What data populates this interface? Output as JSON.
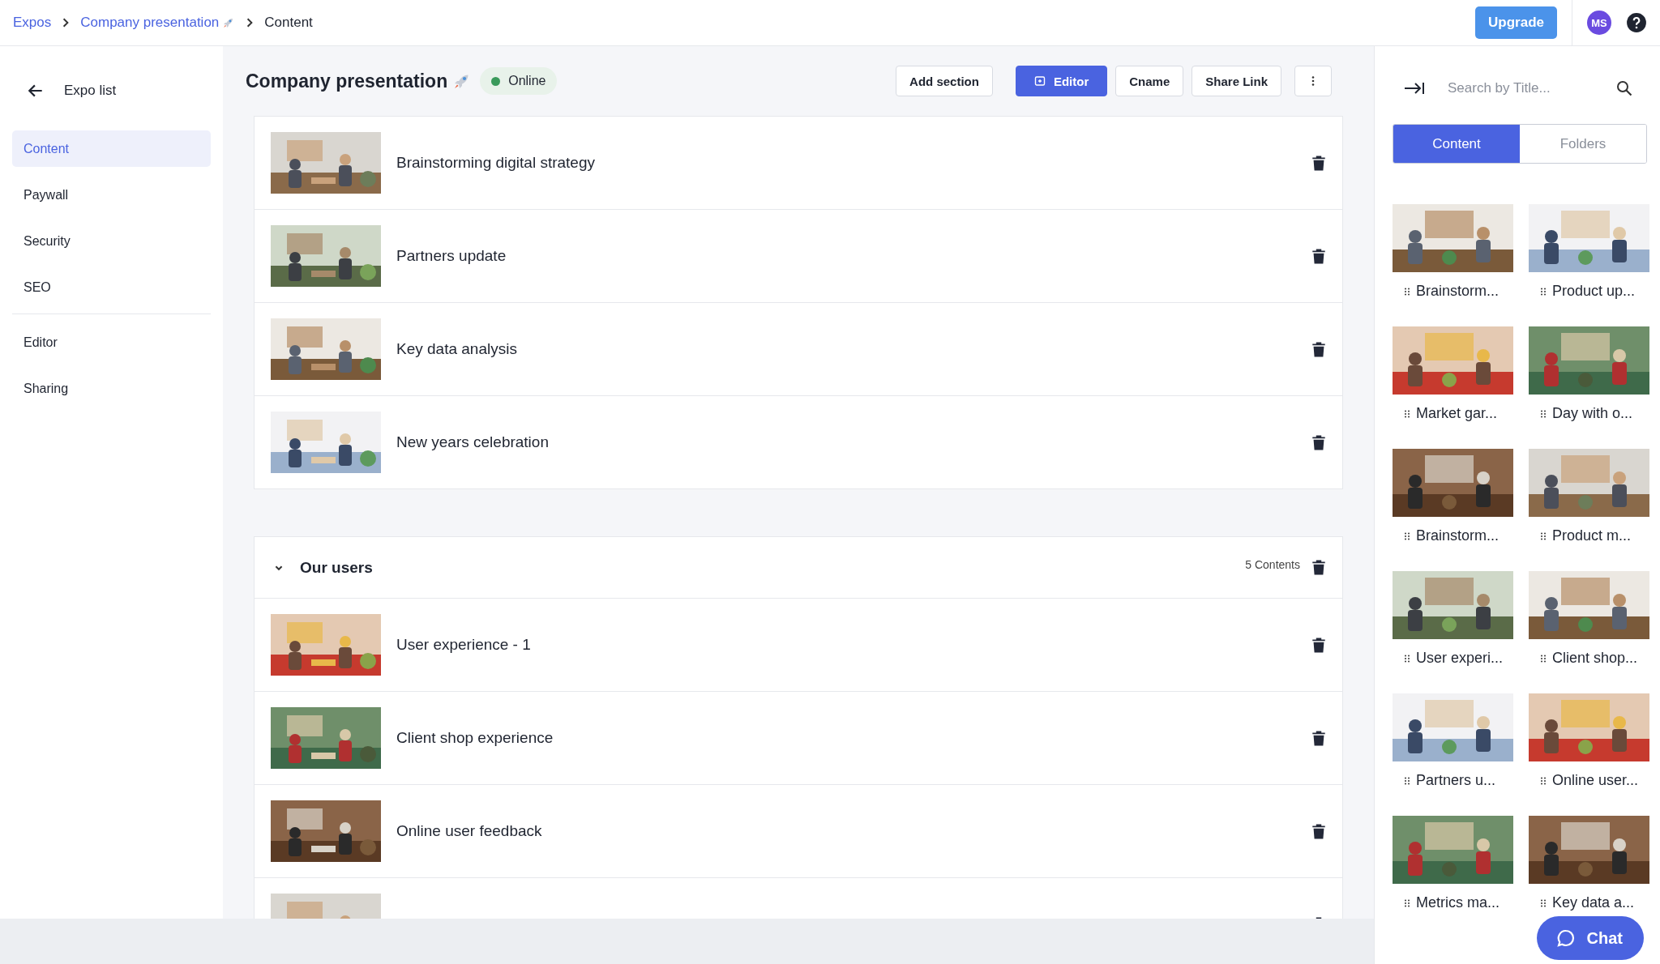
{
  "breadcrumb": [
    {
      "label": "Expos"
    },
    {
      "label": "Company presentation"
    },
    {
      "label": "Content"
    }
  ],
  "topbar": {
    "upgrade": "Upgrade",
    "avatar": "MS"
  },
  "sidebar": {
    "back": "Expo list",
    "groups": [
      [
        {
          "label": "Content",
          "selected": true
        },
        {
          "label": "Paywall",
          "selected": false
        },
        {
          "label": "Security",
          "selected": false
        },
        {
          "label": "SEO",
          "selected": false
        }
      ],
      [
        {
          "label": "Editor",
          "selected": false
        },
        {
          "label": "Sharing",
          "selected": false
        }
      ]
    ]
  },
  "header": {
    "title": "Company presentation",
    "status": "Online",
    "online": true,
    "buttons": [
      {
        "kind": "default",
        "label": "Add section"
      },
      {
        "kind": "primary",
        "label": "Editor"
      },
      {
        "kind": "default",
        "label": "Cname"
      },
      {
        "kind": "default",
        "label": "Share Link"
      },
      {
        "kind": "more"
      }
    ]
  },
  "sections": [
    {
      "items": [
        {
          "kind": "content",
          "title": "Brainstorming digital strategy"
        },
        {
          "kind": "content",
          "title": "Partners update"
        },
        {
          "kind": "content",
          "title": "Key data analysis"
        },
        {
          "kind": "content",
          "title": "New years celebration"
        }
      ]
    },
    {
      "title": "Our users",
      "count": "5 Contents",
      "expanded": true,
      "items": [
        {
          "kind": "content",
          "title": "User experience - 1"
        },
        {
          "kind": "content",
          "title": "Client shop experience"
        },
        {
          "kind": "content",
          "title": "Online user feedback"
        },
        {
          "kind": "picture"
        }
      ]
    }
  ],
  "library": {
    "search": {
      "placeholder": "Search by Title..."
    },
    "tabs": [
      {
        "label": "Content",
        "selected": true
      },
      {
        "label": "Folders",
        "selected": false
      }
    ],
    "items": [
      {
        "caption": "Brainstorm..."
      },
      {
        "caption": "Product up..."
      },
      {
        "caption": "Market gar..."
      },
      {
        "caption": "Day with o..."
      },
      {
        "caption": "Brainstorm..."
      },
      {
        "caption": "Product m..."
      },
      {
        "caption": "User experi..."
      },
      {
        "caption": "Client shop..."
      },
      {
        "caption": "Partners u..."
      },
      {
        "caption": "Online user..."
      },
      {
        "caption": "Metrics ma..."
      },
      {
        "caption": "Key data a..."
      }
    ]
  },
  "chat": {
    "label": "Chat"
  }
}
